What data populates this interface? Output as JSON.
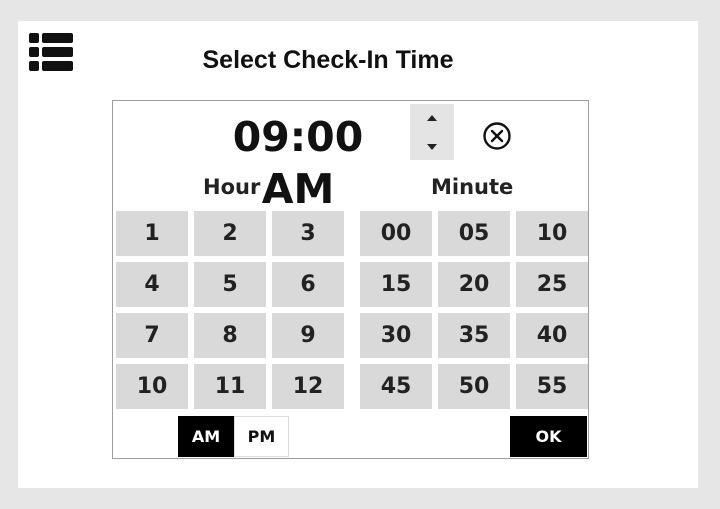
{
  "header": {
    "title": "Select Check-In Time",
    "menu_icon": "list-menu-icon"
  },
  "time_picker": {
    "display_value": "09:00 AM",
    "spinner": {
      "up_glyph": "▲",
      "down_glyph": "▼"
    },
    "clear_icon": "circle-x-icon",
    "hour_label": "Hour",
    "minute_label": "Minute",
    "hours": [
      "1",
      "2",
      "3",
      "4",
      "5",
      "6",
      "7",
      "8",
      "9",
      "10",
      "11",
      "12"
    ],
    "minutes": [
      "00",
      "05",
      "10",
      "15",
      "20",
      "25",
      "30",
      "35",
      "40",
      "45",
      "50",
      "55"
    ],
    "am_label": "AM",
    "pm_label": "PM",
    "selected_period": "AM",
    "ok_label": "OK"
  },
  "colors": {
    "page_background": "#e6e6e6",
    "card_background": "#ffffff",
    "cell_background": "#d9d9d9",
    "active_button": "#000000"
  }
}
